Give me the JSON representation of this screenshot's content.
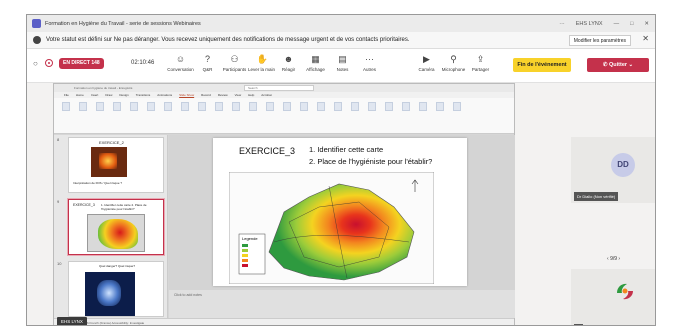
{
  "titlebar": {
    "title": "Formation en Hygiène du Travail - serie de sessions Webinaires",
    "user": "EHS LYNX",
    "controls": [
      "···",
      "—",
      "□",
      "✕"
    ]
  },
  "banner": {
    "message": "Votre statut est défini sur Ne pas déranger. Vous recevez uniquement des notifications de message urgent et de vos contacts prioritaires.",
    "button": "Modifier les paramètres",
    "close": "✕"
  },
  "toolbar": {
    "live_label": "EN DIRECT",
    "rec_badge": "148",
    "timer": "02:10:46",
    "tools": [
      {
        "label": "Conversation",
        "icon": "chat-icon",
        "glyph": "☺"
      },
      {
        "label": "Q&R",
        "icon": "qa-icon",
        "glyph": "?"
      },
      {
        "label": "Participants",
        "icon": "people-icon",
        "glyph": "⚇"
      },
      {
        "label": "Lever la main",
        "icon": "hand-icon",
        "glyph": "✋"
      },
      {
        "label": "Réagir",
        "icon": "react-icon",
        "glyph": "☻"
      },
      {
        "label": "Affichage",
        "icon": "view-icon",
        "glyph": "▦"
      },
      {
        "label": "Notes",
        "icon": "notes-icon",
        "glyph": "▤"
      },
      {
        "label": "Autres",
        "icon": "more-icon",
        "glyph": "···"
      },
      {
        "label": "Caméra",
        "icon": "camera-icon",
        "glyph": "▶"
      },
      {
        "label": "Microphone",
        "icon": "microphone-icon",
        "glyph": "⚲"
      },
      {
        "label": "Partager",
        "icon": "share-icon",
        "glyph": "⇪"
      }
    ],
    "end_event": "Fin de l'événement",
    "quit": "Quitter"
  },
  "ppt": {
    "window_title": "Formation en hygiène du travail - Enregistré",
    "search_placeholder": "Search",
    "tabs": [
      "File",
      "Home",
      "Insert",
      "Draw",
      "Design",
      "Transitions",
      "Animations",
      "Slide Show",
      "Record",
      "Review",
      "View",
      "Help",
      "Acrobat"
    ],
    "active_tab": "Slide Show",
    "notes_placeholder": "Click to add notes",
    "status": "Slide 9 of 16     French (France)     Accessibility: Investigate"
  },
  "thumbnails": [
    {
      "num": "8",
      "title": "EXERCICE_2",
      "caption": "Interprétation de FDS / Quel risque ?"
    },
    {
      "num": "9",
      "title": "EXERCICE_3",
      "caption": "1. Identifier cette carte  2. Place de l'hygiéniste pour l'établir?"
    },
    {
      "num": "10",
      "title": "",
      "caption": "Quel danger? Quel risque?"
    }
  ],
  "slide": {
    "title": "EXERCICE_3",
    "q1": "1. Identifier cette carte",
    "q2": "2. Place de l'hygiéniste pour l'établir?",
    "legend_title": "Legende"
  },
  "speaker_tag": "EHS LYNX",
  "participant": {
    "initials": "DD",
    "name": "Dr Diallo (Non vérifié)",
    "pager": "9/9"
  },
  "colors": {
    "accent": "#5b5fc7",
    "live": "#c4314b",
    "end": "#f8d22a",
    "quit": "#c4314b"
  }
}
